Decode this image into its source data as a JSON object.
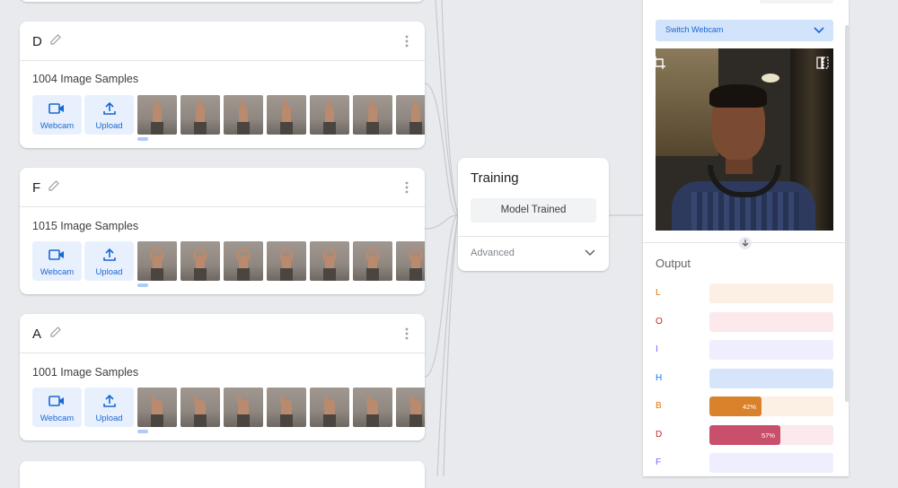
{
  "classes": [
    {
      "name": "D",
      "samples": "1004 Image Samples",
      "webcam": "Webcam",
      "upload": "Upload",
      "gesture": "finger"
    },
    {
      "name": "F",
      "samples": "1015 Image Samples",
      "webcam": "Webcam",
      "upload": "Upload",
      "gesture": "ring"
    },
    {
      "name": "A",
      "samples": "1001 Image Samples",
      "webcam": "Webcam",
      "upload": "Upload",
      "gesture": "fist"
    }
  ],
  "training": {
    "title": "Training",
    "button": "Model Trained",
    "advanced": "Advanced"
  },
  "preview": {
    "switch_webcam": "Switch Webcam",
    "output_title": "Output",
    "outputs": [
      {
        "label": "L",
        "color": "#e37400",
        "bg": "#fcefe3",
        "value": 0,
        "pct": ""
      },
      {
        "label": "O",
        "color": "#c5221f",
        "bg": "#fbe9ec",
        "value": 0,
        "pct": ""
      },
      {
        "label": "I",
        "color": "#7b61ff",
        "bg": "#efeefe",
        "value": 0,
        "pct": ""
      },
      {
        "label": "H",
        "color": "#1a73e8",
        "bg": "#d7e5fb",
        "value": 0,
        "pct": ""
      },
      {
        "label": "B",
        "color": "#e37400",
        "bg": "#fcefe3",
        "value": 0.42,
        "pct": "42%",
        "fill": "#d9822b"
      },
      {
        "label": "D",
        "color": "#c5221f",
        "bg": "#fbe9ec",
        "value": 0.57,
        "pct": "57%",
        "fill": "#c9506a"
      },
      {
        "label": "F",
        "color": "#7b61ff",
        "bg": "#efeefe",
        "value": 0,
        "pct": ""
      }
    ]
  },
  "icons": [
    "pencil-icon",
    "more-vert-icon",
    "videocam-icon",
    "upload-icon",
    "chevron-down-icon",
    "crop-icon",
    "flip-icon",
    "arrow-down-icon"
  ]
}
